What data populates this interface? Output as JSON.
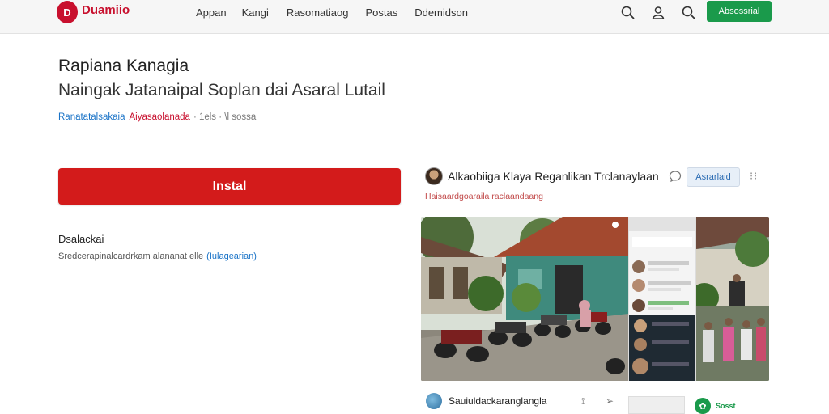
{
  "header": {
    "logo_mark": "D",
    "logo_name": "Duamiio",
    "logo_sub": "",
    "nav": [
      "Appan",
      "Kangi",
      "Rasomatiaog",
      "Postas",
      "Ddemidson"
    ],
    "signin_label": "Absossrial",
    "accent_color": "#c8102e",
    "button_color": "#1a9a4b",
    "icons": [
      "search-icon",
      "user-icon",
      "search-icon"
    ]
  },
  "app": {
    "title": "Rapiana Kanagia",
    "subtitle": "Naingak Jatanaipal Soplan dai Asaral Lutail",
    "developer": "Ranatatalsakaia",
    "category": "Aiyasaolanada",
    "meta_rest": "· 1els · \\l sossa",
    "install_label": "Instal"
  },
  "description": {
    "title": "Dsalackai",
    "text": "Sredcerapinalcardrkam alananat elle",
    "more": "(Iulagearian)"
  },
  "card": {
    "title": "Alkaobiiga Klaya Reganlikan Trclanaylaan",
    "badge": "Asrarlaid",
    "subtitle": "Haisaardgoaraila raclaandaang",
    "bottom_name": "Sauiuldackaranglangla",
    "bottom_thumb_text": "",
    "bottom_pill_label": "Sosst"
  }
}
